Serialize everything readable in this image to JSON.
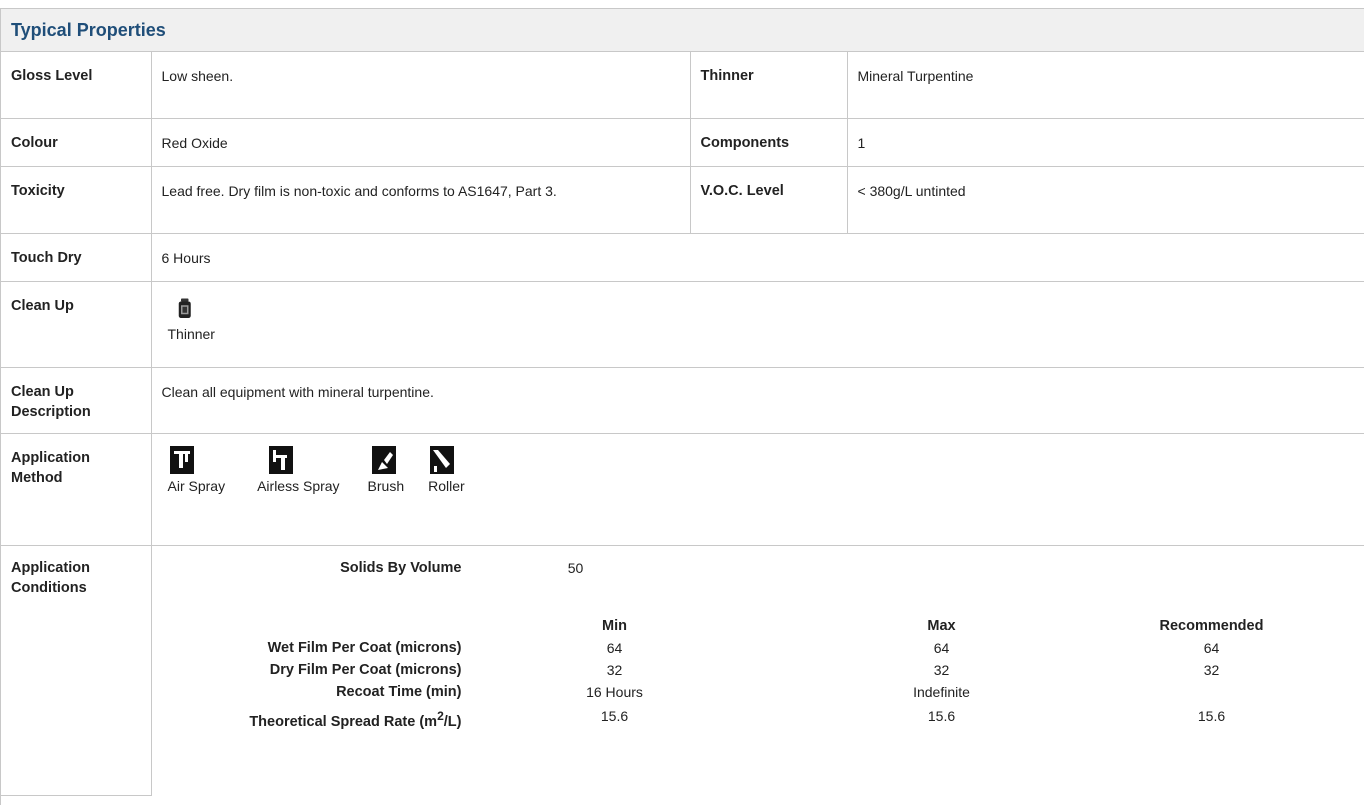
{
  "section_title": "Typical Properties",
  "rows": {
    "gloss": {
      "label": "Gloss Level",
      "value": "Low sheen."
    },
    "thinner": {
      "label": "Thinner",
      "value": "Mineral Turpentine"
    },
    "colour": {
      "label": "Colour",
      "value": "Red Oxide"
    },
    "components": {
      "label": "Components",
      "value": "1"
    },
    "toxicity": {
      "label": "Toxicity",
      "value": "Lead free. Dry film is non-toxic and conforms to AS1647, Part 3."
    },
    "voc": {
      "label": "V.O.C. Level",
      "value": "< 380g/L untinted"
    },
    "touch_dry": {
      "label": "Touch Dry",
      "value": "6 Hours"
    },
    "clean_up": {
      "label": "Clean Up",
      "icon": "thinner-can-icon",
      "caption": "Thinner"
    },
    "clean_up_desc": {
      "label": "Clean Up Description",
      "value": "Clean all equipment with mineral turpentine."
    },
    "application_method": {
      "label": "Application Method",
      "methods": [
        {
          "icon": "air-spray-icon",
          "caption": "Air Spray"
        },
        {
          "icon": "airless-spray-icon",
          "caption": "Airless Spray"
        },
        {
          "icon": "brush-icon",
          "caption": "Brush"
        },
        {
          "icon": "roller-icon",
          "caption": "Roller"
        }
      ]
    },
    "application_conditions": {
      "label": "Application Conditions",
      "solids_label": "Solids By Volume",
      "solids_value": "50",
      "columns": [
        "Min",
        "Max",
        "Recommended"
      ],
      "items": [
        {
          "label": "Wet Film Per Coat (microns)",
          "min": "64",
          "max": "64",
          "rec": "64"
        },
        {
          "label": "Dry Film Per Coat (microns)",
          "min": "32",
          "max": "32",
          "rec": "32"
        },
        {
          "label": "Recoat Time (min)",
          "min": "16 Hours",
          "max": "Indefinite",
          "rec": ""
        },
        {
          "label_prefix": "Theoretical Spread Rate (m",
          "label_sup": "2",
          "label_suffix": "/L)",
          "min": "15.6",
          "max": "15.6",
          "rec": "15.6"
        }
      ]
    }
  },
  "colors": {
    "title": "#1f4e79",
    "header_bg": "#f0f0f0",
    "border": "#c8c8c8"
  }
}
